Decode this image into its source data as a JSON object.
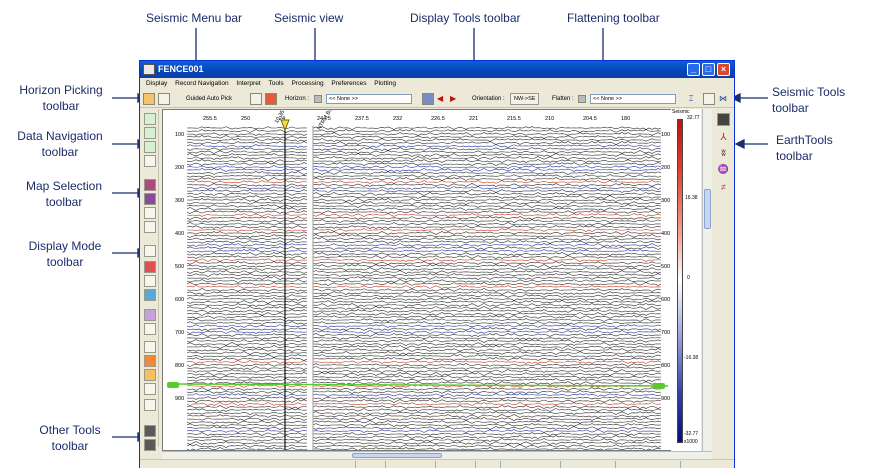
{
  "callouts": {
    "seismic_menu_bar": "Seismic Menu bar",
    "seismic_view": "Seismic view",
    "display_tools_toolbar": "Display Tools toolbar",
    "flattening_toolbar": "Flattening toolbar",
    "horizon_picking": [
      "Horizon Picking",
      "toolbar"
    ],
    "data_navigation": [
      "Data Navigation",
      "toolbar"
    ],
    "map_selection": [
      "Map Selection",
      "toolbar"
    ],
    "display_mode": [
      "Display Mode",
      "toolbar"
    ],
    "other_tools": [
      "Other Tools",
      "toolbar"
    ],
    "seismic_tools": [
      "Seismic Tools",
      "toolbar"
    ],
    "earth_tools": [
      "EarthTools",
      "toolbar"
    ]
  },
  "window": {
    "title": "FENCE001"
  },
  "menu": [
    "Display",
    "Record Navigation",
    "Interpret",
    "Tools",
    "Processing",
    "Preferences",
    "Plotting"
  ],
  "toolbar": {
    "guided_auto_pick": "Guided Auto Pick",
    "horizon_label": "Horizon :",
    "horizon_value": "<< None >>",
    "orientation_label": "Orientation :",
    "orientation_value": "NW->SE",
    "flatten_label": "Flatten :",
    "flatten_value": "<< None >>"
  },
  "seismic": {
    "top_ticks": [
      "255.5",
      "250",
      "24",
      "244.5",
      "237.5",
      "232",
      "226.5",
      "221",
      "215.5",
      "210",
      "204.5",
      "180"
    ],
    "depth_ticks": [
      "100",
      "200",
      "300",
      "400",
      "500",
      "600",
      "700",
      "800",
      "900"
    ],
    "well_labels": [
      "10-35",
      "NTR-J BS"
    ]
  },
  "colorbar": {
    "title": "Seismic",
    "labels": [
      "32.77",
      "16.38",
      "0",
      "-16.38",
      "-32.77"
    ],
    "unit": "x1000",
    "colors": {
      "max": "#c0100c",
      "mid": "#ffffff",
      "min": "#0c0c80"
    }
  },
  "colors": {
    "callout_text": "#1a2d6b",
    "title_bar": "#0a5fd8",
    "window_bg": "#ece9d8",
    "horizon_line": "#5cc832"
  }
}
